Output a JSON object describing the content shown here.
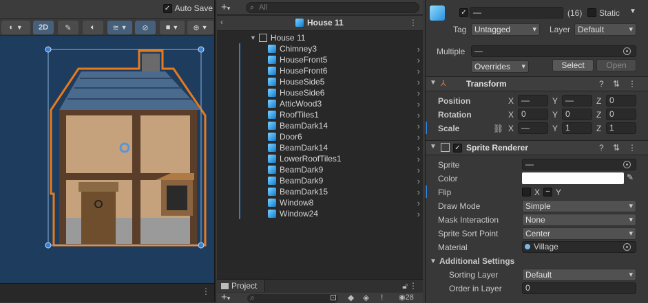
{
  "scene": {
    "autosave_label": "Auto Save",
    "autosave_checked": "✓",
    "btn_2d": "2D"
  },
  "hierarchy": {
    "search_placeholder": "All",
    "scene_name": "House 11",
    "root_object": "House 11",
    "items": [
      "Chimney3",
      "HouseFront5",
      "HouseFront6",
      "HouseSide5",
      "HouseSide6",
      "AtticWood3",
      "RoofTiles1",
      "BeamDark14",
      "Door6",
      "BeamDark14",
      "LowerRoofTiles1",
      "BeamDark9",
      "BeamDark9",
      "BeamDark15",
      "Window8",
      "Window24"
    ]
  },
  "project": {
    "tab_label": "Project",
    "hidden_count": "28"
  },
  "inspector": {
    "name_value": "—",
    "count": "(16)",
    "static_label": "Static",
    "tag_label": "Tag",
    "tag_value": "Untagged",
    "layer_label": "Layer",
    "layer_value": "Default",
    "multiple_label": "Multiple",
    "multiple_value": "—",
    "overrides_label": "Overrides",
    "select_label": "Select",
    "open_label": "Open",
    "transform": {
      "title": "Transform",
      "position_label": "Position",
      "rotation_label": "Rotation",
      "scale_label": "Scale",
      "pos_x": "—",
      "pos_y": "—",
      "pos_z": "0",
      "rot_x": "0",
      "rot_y": "0",
      "rot_z": "0",
      "scale_x": "—",
      "scale_y": "1",
      "scale_z": "1",
      "axis_x": "X",
      "axis_y": "Y",
      "axis_z": "Z"
    },
    "sprite_renderer": {
      "title": "Sprite Renderer",
      "sprite_label": "Sprite",
      "sprite_value": "—",
      "color_label": "Color",
      "flip_label": "Flip",
      "flip_x": "X",
      "flip_y": "Y",
      "draw_mode_label": "Draw Mode",
      "draw_mode_value": "Simple",
      "mask_label": "Mask Interaction",
      "mask_value": "None",
      "sort_point_label": "Sprite Sort Point",
      "sort_point_value": "Center",
      "material_label": "Material",
      "material_value": "Village",
      "additional_label": "Additional Settings",
      "sorting_layer_label": "Sorting Layer",
      "sorting_layer_value": "Default",
      "order_label": "Order in Layer",
      "order_value": "0"
    }
  }
}
